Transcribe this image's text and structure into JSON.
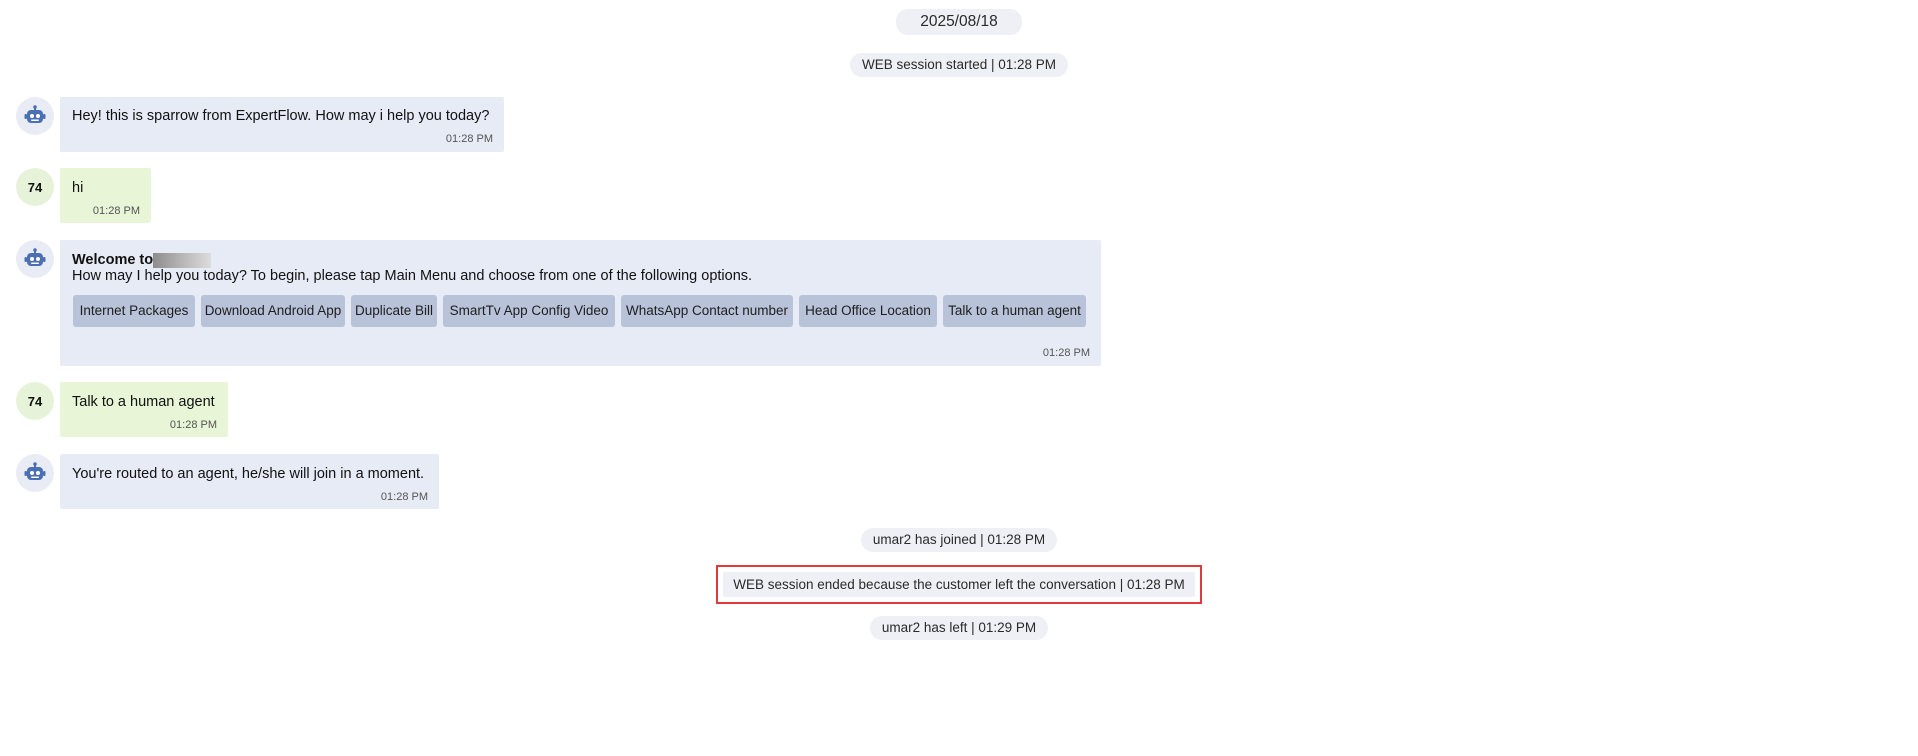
{
  "date": "2025/08/18",
  "events": {
    "session_started": "WEB session started | 01:28 PM",
    "agent_joined": "umar2 has joined | 01:28 PM",
    "session_ended": "WEB session ended because the customer left the conversation | 01:28 PM",
    "agent_left": "umar2 has left | 01:29 PM"
  },
  "customer_initials": "74",
  "messages": [
    {
      "sender": "bot",
      "text": "Hey! this is sparrow from ExpertFlow. How may i help you today?",
      "time": "01:28 PM"
    },
    {
      "sender": "customer",
      "text": "hi",
      "time": "01:28 PM"
    },
    {
      "sender": "bot",
      "title": "Welcome to",
      "text": "How may I help you today? To begin, please tap Main Menu and choose from one of the following options.",
      "options": [
        "Internet Packages",
        "Download Android App",
        "Duplicate Bill",
        "SmartTv App Config Video",
        "WhatsApp Contact number",
        "Head Office Location",
        "Talk to a human agent"
      ],
      "time": "01:28 PM"
    },
    {
      "sender": "customer",
      "text": "Talk to a human agent",
      "time": "01:28 PM"
    },
    {
      "sender": "bot",
      "text": "You're routed to an agent, he/she will join in a moment.",
      "time": "01:28 PM"
    }
  ],
  "colors": {
    "bot_bubble": "#e6ebf5",
    "customer_bubble": "#e8f5d6",
    "option_button": "#b8c2d8",
    "bot_icon": "#4a6fb5",
    "highlight_border": "#e03a3e"
  },
  "icons": {
    "bot_avatar": "robot-icon"
  }
}
